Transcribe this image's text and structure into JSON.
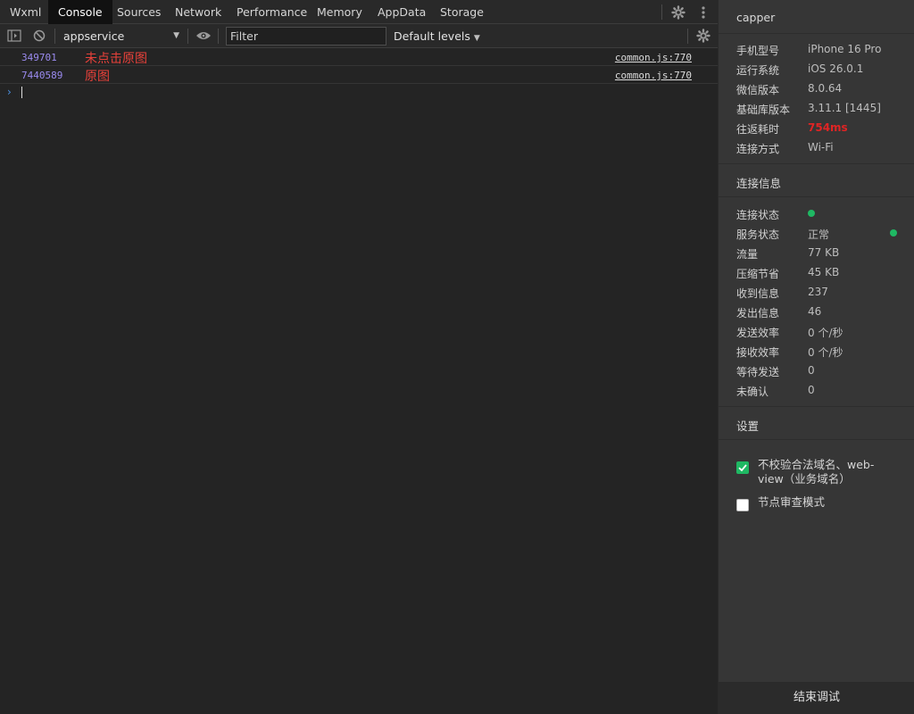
{
  "devtools": {
    "tabs": [
      {
        "label": "Wxml"
      },
      {
        "label": "Console"
      },
      {
        "label": "Sources"
      },
      {
        "label": "Network"
      },
      {
        "label": "Performance"
      },
      {
        "label": "Memory"
      },
      {
        "label": "AppData"
      },
      {
        "label": "Storage"
      }
    ],
    "active_tab": "Console",
    "toolbar": {
      "context": "appservice",
      "filter_placeholder": "Filter",
      "levels": "Default levels"
    },
    "logs": [
      {
        "count": "349701",
        "message": "未点击原图",
        "source": "common.js:770"
      },
      {
        "count": "7440589",
        "message": "原图",
        "source": "common.js:770"
      }
    ],
    "prompt_symbol": "›"
  },
  "side_panel": {
    "header": "capper",
    "device_info": [
      {
        "label": "手机型号",
        "value": "iPhone 16 Pro"
      },
      {
        "label": "运行系统",
        "value": "iOS 26.0.1"
      },
      {
        "label": "微信版本",
        "value": "8.0.64"
      },
      {
        "label": "基础库版本",
        "value": "3.11.1 [1445]"
      },
      {
        "label": "往返耗时",
        "value": "754ms"
      },
      {
        "label": "连接方式",
        "value": "Wi-Fi"
      }
    ],
    "connection_title": "连接信息",
    "connection_info": [
      {
        "label": "连接状态",
        "value": ""
      },
      {
        "label": "服务状态",
        "value": "正常"
      },
      {
        "label": "流量",
        "value": "77 KB"
      },
      {
        "label": "压缩节省",
        "value": "45 KB"
      },
      {
        "label": "收到信息",
        "value": "237"
      },
      {
        "label": "发出信息",
        "value": "46"
      },
      {
        "label": "发送效率",
        "value": "0 个/秒"
      },
      {
        "label": "接收效率",
        "value": "0 个/秒"
      },
      {
        "label": "等待发送",
        "value": "0"
      },
      {
        "label": "未确认",
        "value": "0"
      }
    ],
    "settings_title": "设置",
    "settings": [
      {
        "label": "不校验合法域名、web-view（业务域名）",
        "checked": true
      },
      {
        "label": "节点审查模式",
        "checked": false
      }
    ],
    "end_button": "结束调试"
  },
  "colors": {
    "status_ok": "#1fb863",
    "latency_red": "#e02424",
    "log_error": "#e8413a",
    "log_count": "#9b8bf0"
  }
}
